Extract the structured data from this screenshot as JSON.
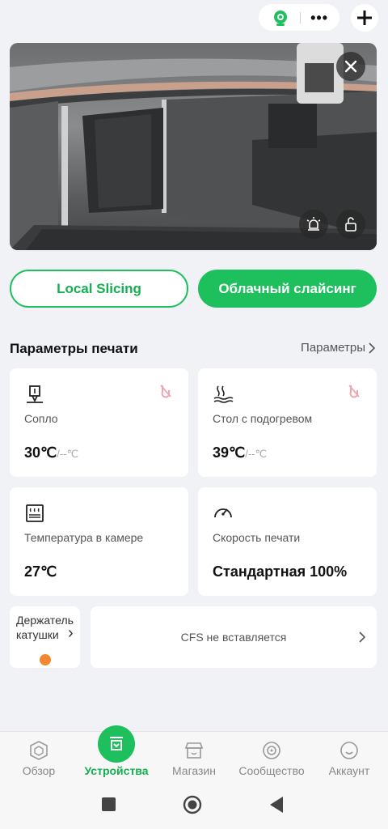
{
  "header": {
    "more_label": "•••",
    "add_label": "+"
  },
  "camera": {
    "close_icon": "close-icon",
    "light_icon": "light-icon",
    "lock_icon": "lock-icon"
  },
  "actions": {
    "local_slicing": "Local Slicing",
    "cloud_slicing": "Облачный слайсинг"
  },
  "print_params": {
    "title": "Параметры печати",
    "link": "Параметры",
    "cards": [
      {
        "label": "Сопло",
        "value": "30℃",
        "target": "/--℃"
      },
      {
        "label": "Стол с подогревом",
        "value": "39℃",
        "target": "/--℃"
      },
      {
        "label": "Температура в камере",
        "value": "27℃"
      },
      {
        "label": "Скорость печати",
        "value": "Стандартная 100%"
      }
    ]
  },
  "spool": {
    "label": "Держатель катушки",
    "chevron": "›"
  },
  "cfs": {
    "label": "CFS не вставляется"
  },
  "nav": {
    "items": [
      {
        "label": "Обзор"
      },
      {
        "label": "Устройства"
      },
      {
        "label": "Магазин"
      },
      {
        "label": "Сообщество"
      },
      {
        "label": "Аккаунт"
      }
    ]
  },
  "colors": {
    "accent": "#1ec05e",
    "spool_color": "#f2882f"
  }
}
